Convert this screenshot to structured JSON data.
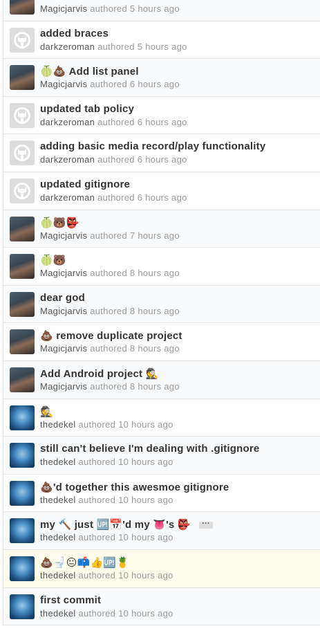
{
  "commits": [
    {
      "message": "... ...",
      "author": "Magicjarvis",
      "action": "authored",
      "time": "5 hours ago",
      "avatar": "magicjarvis"
    },
    {
      "message": "added braces",
      "author": "darkzeroman",
      "action": "authored",
      "time": "5 hours ago",
      "avatar": "github-default"
    },
    {
      "message": "🍈💩 Add list panel",
      "author": "Magicjarvis",
      "action": "authored",
      "time": "6 hours ago",
      "avatar": "magicjarvis"
    },
    {
      "message": "updated tab policy",
      "author": "darkzeroman",
      "action": "authored",
      "time": "6 hours ago",
      "avatar": "github-default"
    },
    {
      "message": "adding basic media record/play functionality",
      "author": "darkzeroman",
      "action": "authored",
      "time": "6 hours ago",
      "avatar": "github-default"
    },
    {
      "message": "updated gitignore",
      "author": "darkzeroman",
      "action": "authored",
      "time": "6 hours ago",
      "avatar": "github-default"
    },
    {
      "message": "🍈🐻👺",
      "author": "Magicjarvis",
      "action": "authored",
      "time": "7 hours ago",
      "avatar": "magicjarvis"
    },
    {
      "message": "🍈🐻",
      "author": "Magicjarvis",
      "action": "authored",
      "time": "8 hours ago",
      "avatar": "magicjarvis"
    },
    {
      "message": "dear god",
      "author": "Magicjarvis",
      "action": "authored",
      "time": "8 hours ago",
      "avatar": "magicjarvis"
    },
    {
      "message": "💩 remove duplicate project",
      "author": "Magicjarvis",
      "action": "authored",
      "time": "8 hours ago",
      "avatar": "magicjarvis"
    },
    {
      "message": "Add Android project 🕵",
      "author": "Magicjarvis",
      "action": "authored",
      "time": "8 hours ago",
      "avatar": "magicjarvis"
    },
    {
      "message": "🕵",
      "author": "thedekel",
      "action": "authored",
      "time": "10 hours ago",
      "avatar": "thedekel"
    },
    {
      "message": "still can't believe I'm dealing with .gitignore",
      "author": "thedekel",
      "action": "authored",
      "time": "10 hours ago",
      "avatar": "thedekel"
    },
    {
      "message": "💩'd together this awesmoe gitignore",
      "author": "thedekel",
      "action": "authored",
      "time": "10 hours ago",
      "avatar": "thedekel"
    },
    {
      "message": "my 🔨 just 🆙📅'd my 👅's 👺",
      "author": "thedekel",
      "action": "authored",
      "time": "10 hours ago",
      "avatar": "thedekel",
      "expand": "···"
    },
    {
      "message": "💩🚽😐📫👍🆙🍍",
      "author": "thedekel",
      "action": "authored",
      "time": "10 hours ago",
      "avatar": "thedekel"
    },
    {
      "message": "first commit",
      "author": "thedekel",
      "action": "authored",
      "time": "10 hours ago",
      "avatar": "thedekel"
    }
  ]
}
